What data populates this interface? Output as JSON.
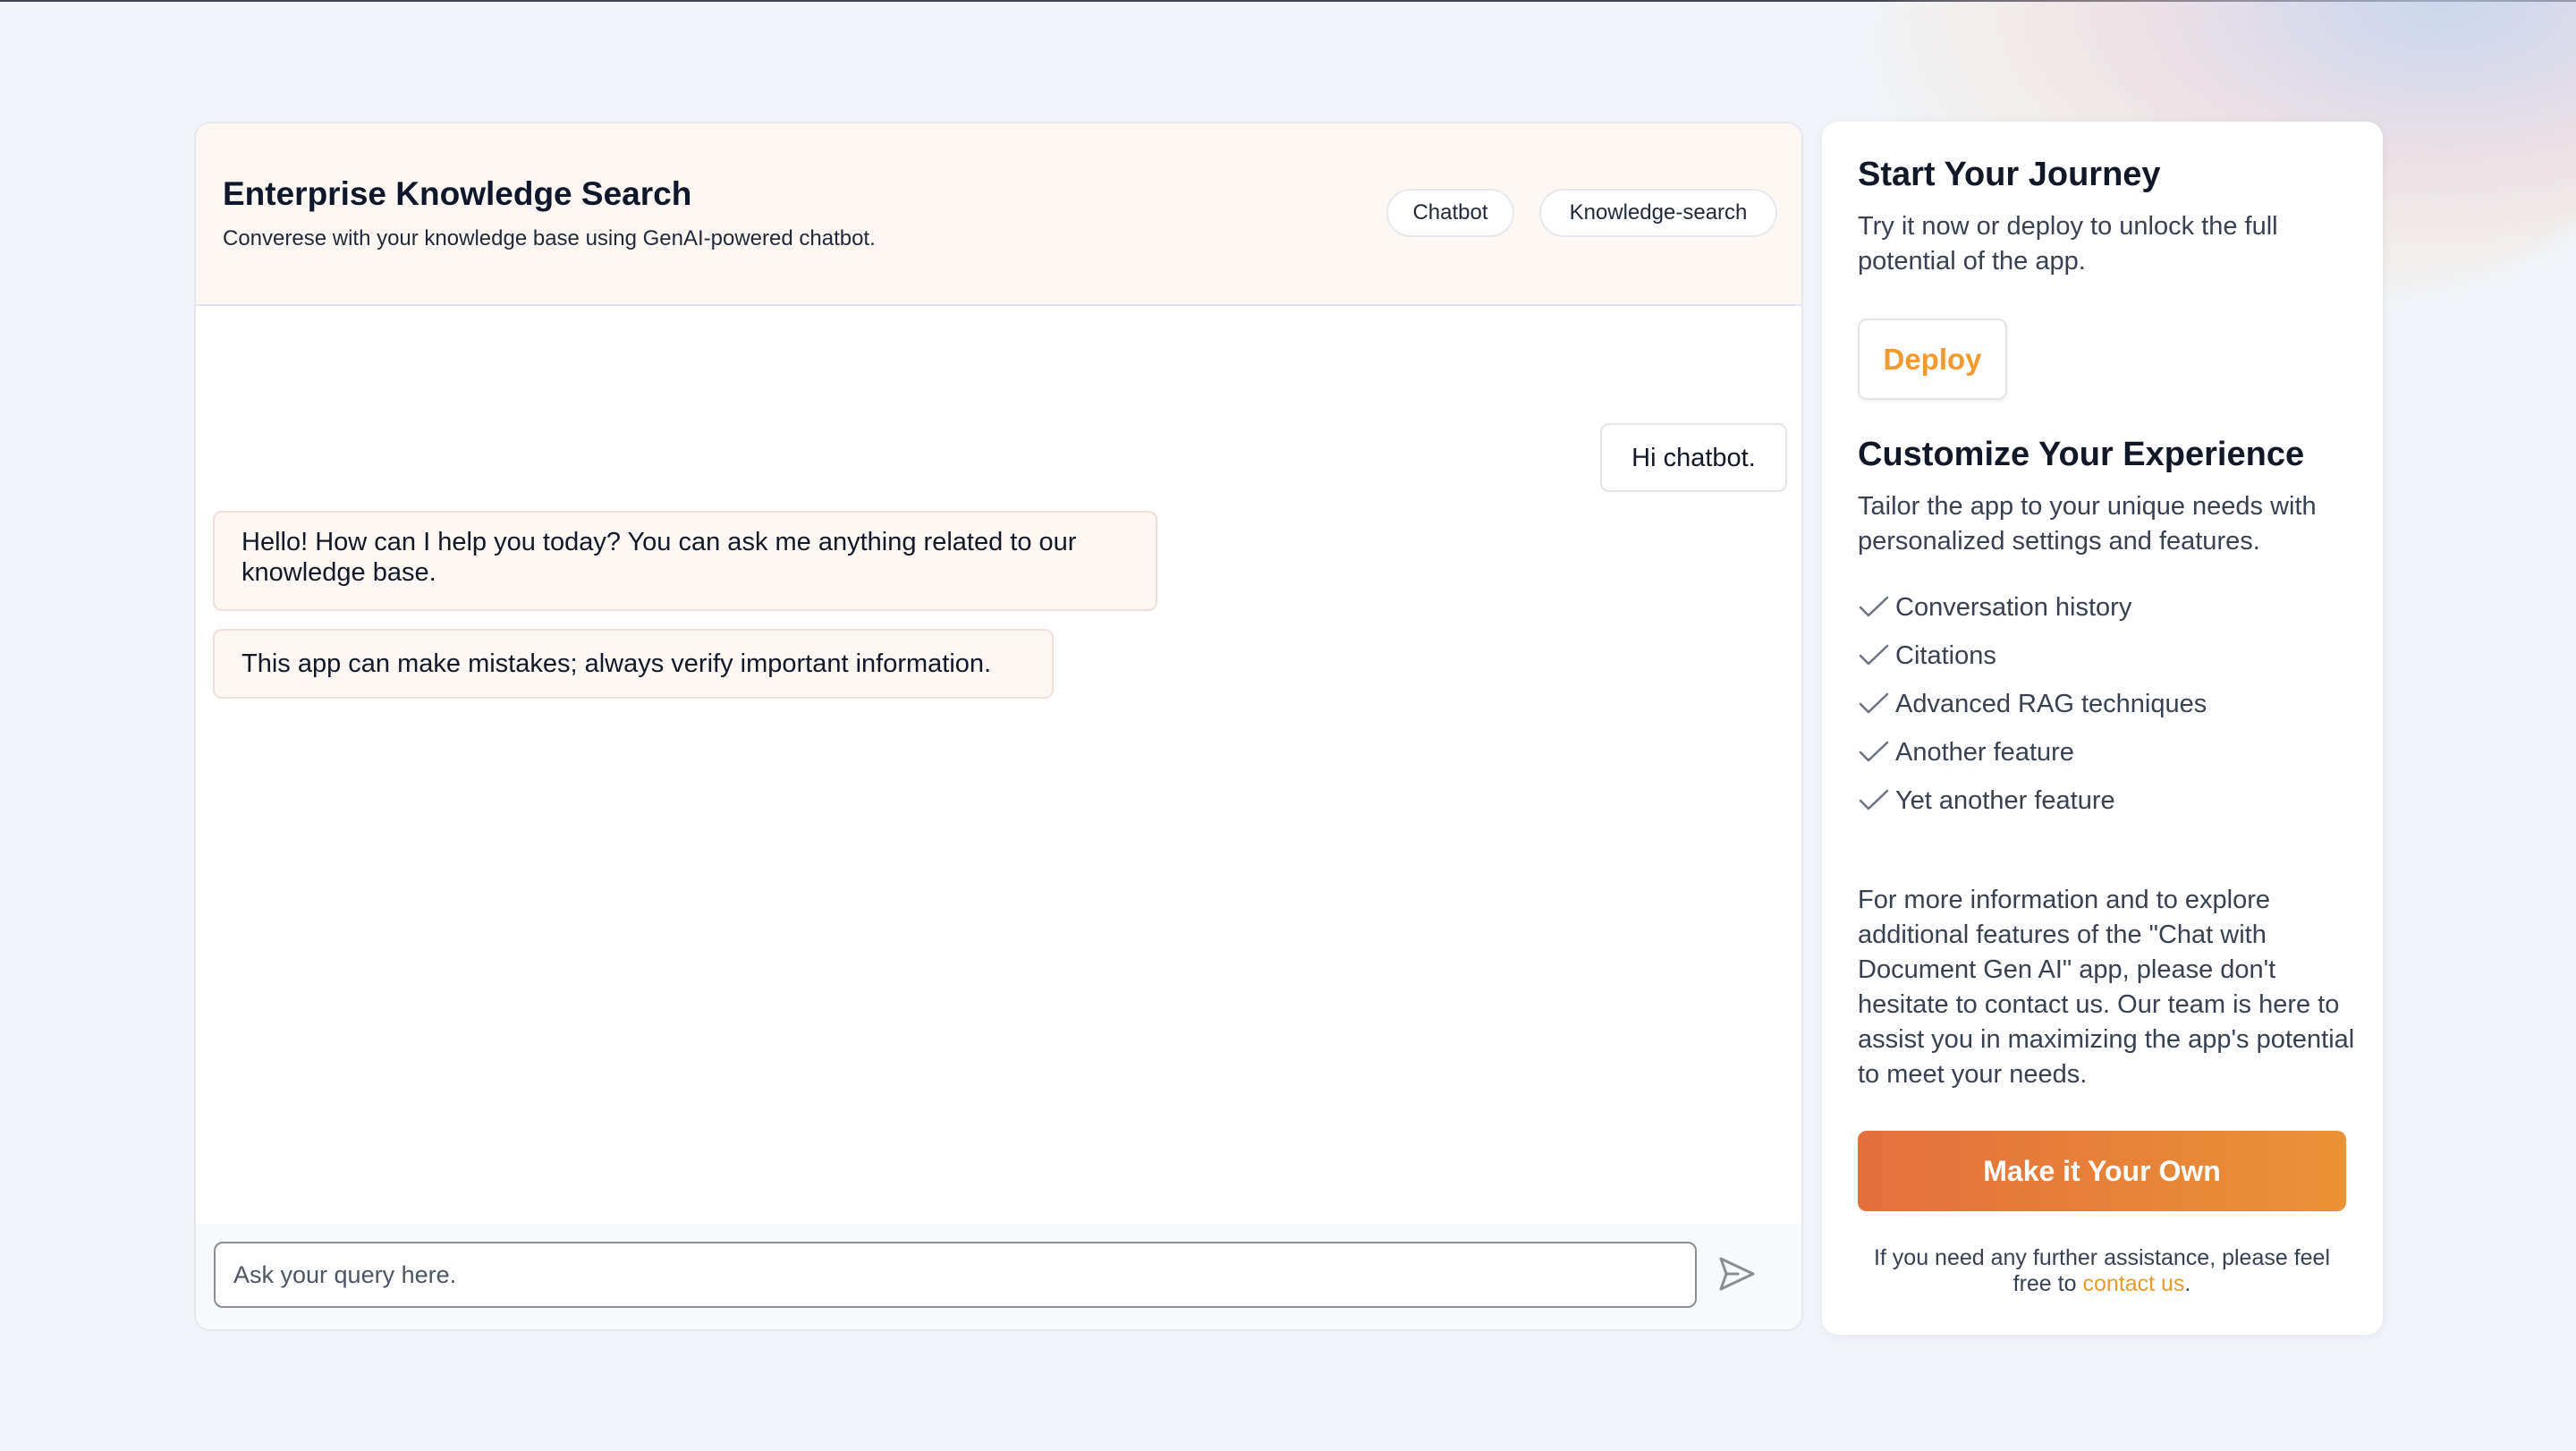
{
  "chat": {
    "title": "Enterprise Knowledge Search",
    "subtitle": "Converese with your knowledge base using GenAI-powered chatbot.",
    "tags": [
      "Chatbot",
      "Knowledge-search"
    ],
    "messages": [
      {
        "role": "user",
        "text": "Hi chatbot."
      },
      {
        "role": "bot",
        "text": "Hello! How can I help you today? You can ask me anything related to our knowledge base."
      },
      {
        "role": "bot",
        "text": "This app can make mistakes; always verify important information."
      }
    ],
    "input": {
      "placeholder": "Ask your query here.",
      "value": ""
    },
    "send_icon": "send-icon"
  },
  "sidebar": {
    "journey_title": "Start Your Journey",
    "journey_text": "Try it now or deploy to unlock the full potential of the app.",
    "deploy_label": "Deploy",
    "customize_title": "Customize Your Experience",
    "customize_text": "Tailor the app to your unique needs with personalized settings and features.",
    "features": [
      "Conversation history",
      "Citations",
      "Advanced RAG techniques",
      "Another feature",
      "Yet another feature"
    ],
    "info_text": "For more information and to explore additional features of the \"Chat with Document Gen AI\" app, please don't hesitate to contact us. Our team is here to assist you in maximizing the app's potential to meet your needs.",
    "cta_label": "Make it Your Own",
    "help_prefix": "If you need any further assistance, please feel free to ",
    "help_link": "contact us",
    "help_suffix": "."
  },
  "colors": {
    "accent": "#f29a2e",
    "cta_start": "#e3703d",
    "cta_end": "#ea9235",
    "bot_bubble": "#fdf7f4"
  }
}
